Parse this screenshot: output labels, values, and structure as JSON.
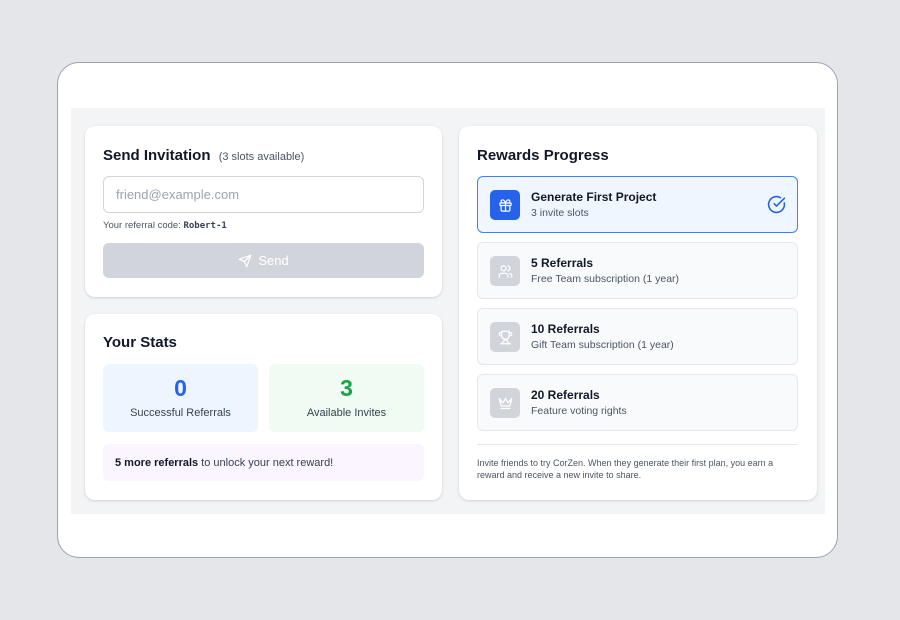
{
  "invite": {
    "title": "Send Invitation",
    "slots_note": "(3 slots available)",
    "email_placeholder": "friend@example.com",
    "email_value": "",
    "referral_prefix": "Your referral code:",
    "referral_code": "Robert-1",
    "send_label": "Send"
  },
  "stats": {
    "title": "Your Stats",
    "successful_value": "0",
    "successful_label": "Successful Referrals",
    "available_value": "3",
    "available_label": "Available Invites",
    "unlock_bold": "5 more referrals",
    "unlock_rest": "to unlock your next reward!"
  },
  "rewards": {
    "title": "Rewards Progress",
    "items": [
      {
        "title": "Generate First Project",
        "subtitle": "3 invite slots",
        "icon": "gift-icon",
        "status": "completed"
      },
      {
        "title": "5 Referrals",
        "subtitle": "Free Team subscription (1 year)",
        "icon": "users-icon",
        "status": "locked"
      },
      {
        "title": "10 Referrals",
        "subtitle": "Gift Team subscription (1 year)",
        "icon": "trophy-icon",
        "status": "locked"
      },
      {
        "title": "20 Referrals",
        "subtitle": "Feature voting rights",
        "icon": "crown-icon",
        "status": "locked"
      }
    ],
    "footer": "Invite friends to try CorZen. When they generate their first plan, you earn a reward and receive a new invite to share."
  },
  "colors": {
    "accent": "#2563eb",
    "success": "#16a34a",
    "disabled_button": "#d1d5db"
  }
}
